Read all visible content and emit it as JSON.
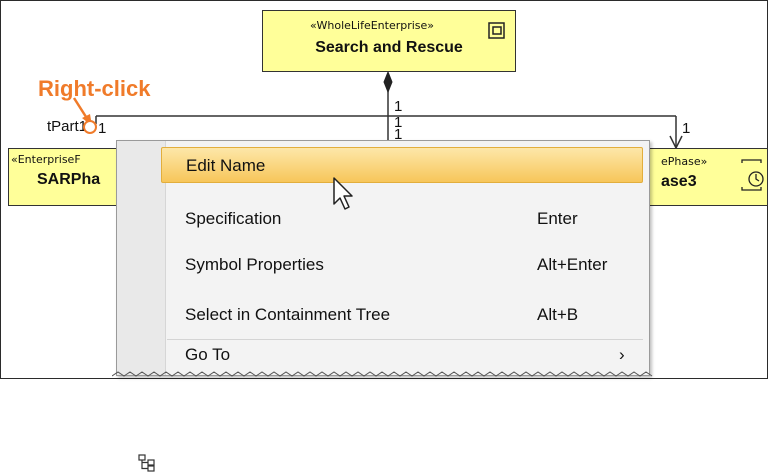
{
  "diagram": {
    "top_block": {
      "stereotype": "«WholeLifeEnterprise»",
      "name": "Search and Rescue"
    },
    "left_block": {
      "stereotype": "«EnterpriseF",
      "name": "SARPha"
    },
    "right_block": {
      "stereotype": "ePhase»",
      "name": "ase3"
    },
    "part_label": "tPart1",
    "multiplicities": [
      "1",
      "1",
      "1",
      "1",
      "1"
    ],
    "annotation": "Right-click"
  },
  "context_menu": {
    "items": [
      {
        "label": "Edit Name",
        "shortcut": ""
      },
      {
        "label": "Specification",
        "shortcut": "Enter"
      },
      {
        "label": "Symbol Properties",
        "shortcut": "Alt+Enter"
      },
      {
        "label": "Select in Containment Tree",
        "shortcut": "Alt+B"
      },
      {
        "label": "Go To",
        "shortcut": "›"
      }
    ]
  },
  "colors": {
    "block_fill": "#ffff99",
    "annotation": "#f07b2a",
    "highlight": "#f7c65a"
  }
}
